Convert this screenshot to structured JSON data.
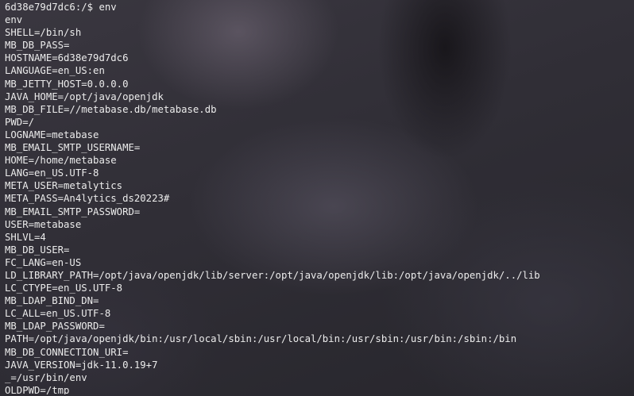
{
  "terminal": {
    "prompt": "6d38e79d7dc6:/$ env",
    "lines": [
      "env",
      "SHELL=/bin/sh",
      "MB_DB_PASS=",
      "HOSTNAME=6d38e79d7dc6",
      "LANGUAGE=en_US:en",
      "MB_JETTY_HOST=0.0.0.0",
      "JAVA_HOME=/opt/java/openjdk",
      "MB_DB_FILE=//metabase.db/metabase.db",
      "PWD=/",
      "LOGNAME=metabase",
      "MB_EMAIL_SMTP_USERNAME=",
      "HOME=/home/metabase",
      "LANG=en_US.UTF-8",
      "META_USER=metalytics",
      "META_PASS=An4lytics_ds20223#",
      "MB_EMAIL_SMTP_PASSWORD=",
      "USER=metabase",
      "SHLVL=4",
      "MB_DB_USER=",
      "FC_LANG=en-US",
      "LD_LIBRARY_PATH=/opt/java/openjdk/lib/server:/opt/java/openjdk/lib:/opt/java/openjdk/../lib",
      "LC_CTYPE=en_US.UTF-8",
      "MB_LDAP_BIND_DN=",
      "LC_ALL=en_US.UTF-8",
      "MB_LDAP_PASSWORD=",
      "PATH=/opt/java/openjdk/bin:/usr/local/sbin:/usr/local/bin:/usr/sbin:/usr/bin:/sbin:/bin",
      "MB_DB_CONNECTION_URI=",
      "JAVA_VERSION=jdk-11.0.19+7",
      "_=/usr/bin/env",
      "OLDPWD=/tmp"
    ]
  }
}
